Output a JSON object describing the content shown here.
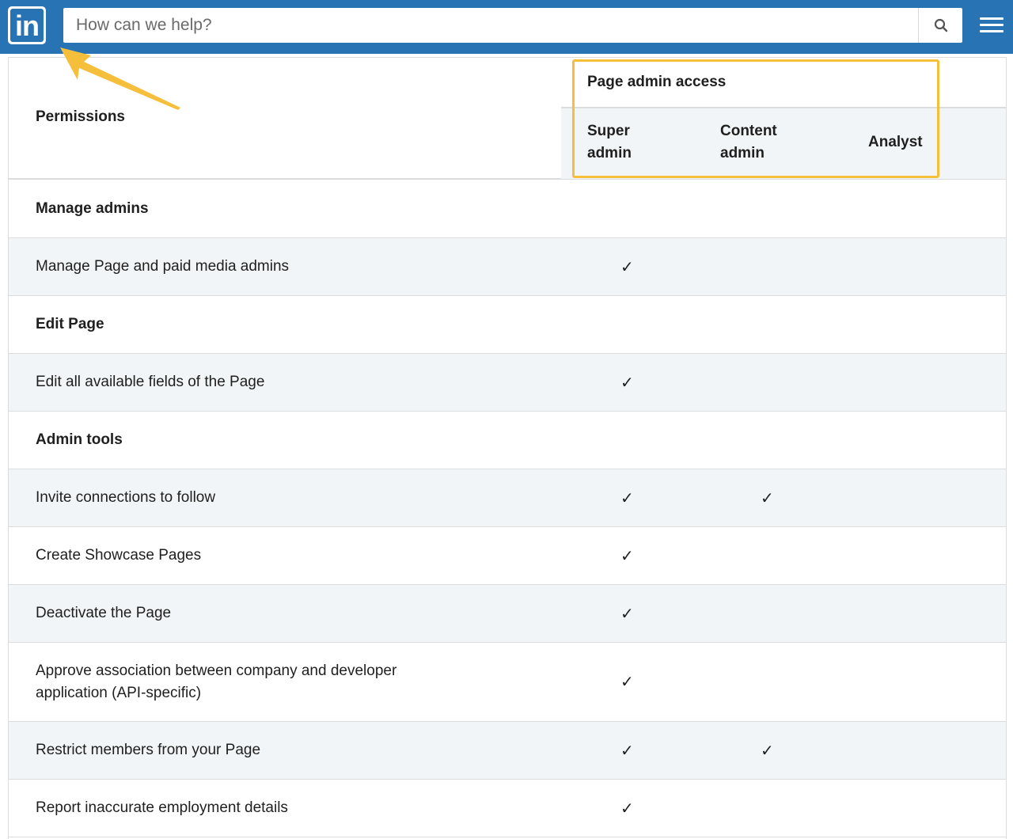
{
  "header": {
    "logo_text": "in",
    "search_placeholder": "How can we help?",
    "brand_color": "#2873b4"
  },
  "table": {
    "permissions_header": "Permissions",
    "access_group_header": "Page admin access",
    "columns": [
      {
        "line1": "Super",
        "line2": "admin"
      },
      {
        "line1": "Content",
        "line2": "admin"
      },
      {
        "line1": "Analyst",
        "line2": ""
      }
    ],
    "rows": [
      {
        "label": "Manage admins",
        "type": "section",
        "checks": [
          false,
          false,
          false
        ]
      },
      {
        "label": "Manage Page and paid media admins",
        "type": "item",
        "checks": [
          true,
          false,
          false
        ]
      },
      {
        "label": "Edit Page",
        "type": "section",
        "checks": [
          false,
          false,
          false
        ]
      },
      {
        "label": "Edit all available fields of the Page",
        "type": "item",
        "checks": [
          true,
          false,
          false
        ]
      },
      {
        "label": "Admin tools",
        "type": "section",
        "checks": [
          false,
          false,
          false
        ]
      },
      {
        "label": "Invite connections to follow",
        "type": "item",
        "checks": [
          true,
          true,
          false
        ]
      },
      {
        "label": "Create Showcase Pages",
        "type": "item",
        "checks": [
          true,
          false,
          false
        ]
      },
      {
        "label": "Deactivate the Page",
        "type": "item",
        "checks": [
          true,
          false,
          false
        ]
      },
      {
        "label_line1": "Approve association between company and developer",
        "label_line2": "application (API-specific)",
        "type": "item",
        "checks": [
          true,
          false,
          false
        ]
      },
      {
        "label": "Restrict members from your Page",
        "type": "item",
        "checks": [
          true,
          true,
          false
        ]
      },
      {
        "label": "Report inaccurate employment details",
        "type": "item",
        "checks": [
          true,
          false,
          false
        ]
      }
    ],
    "check_glyph": "✓"
  },
  "annotation": {
    "highlight_color": "#f5bf3c",
    "arrow_color": "#f5bf3c"
  }
}
